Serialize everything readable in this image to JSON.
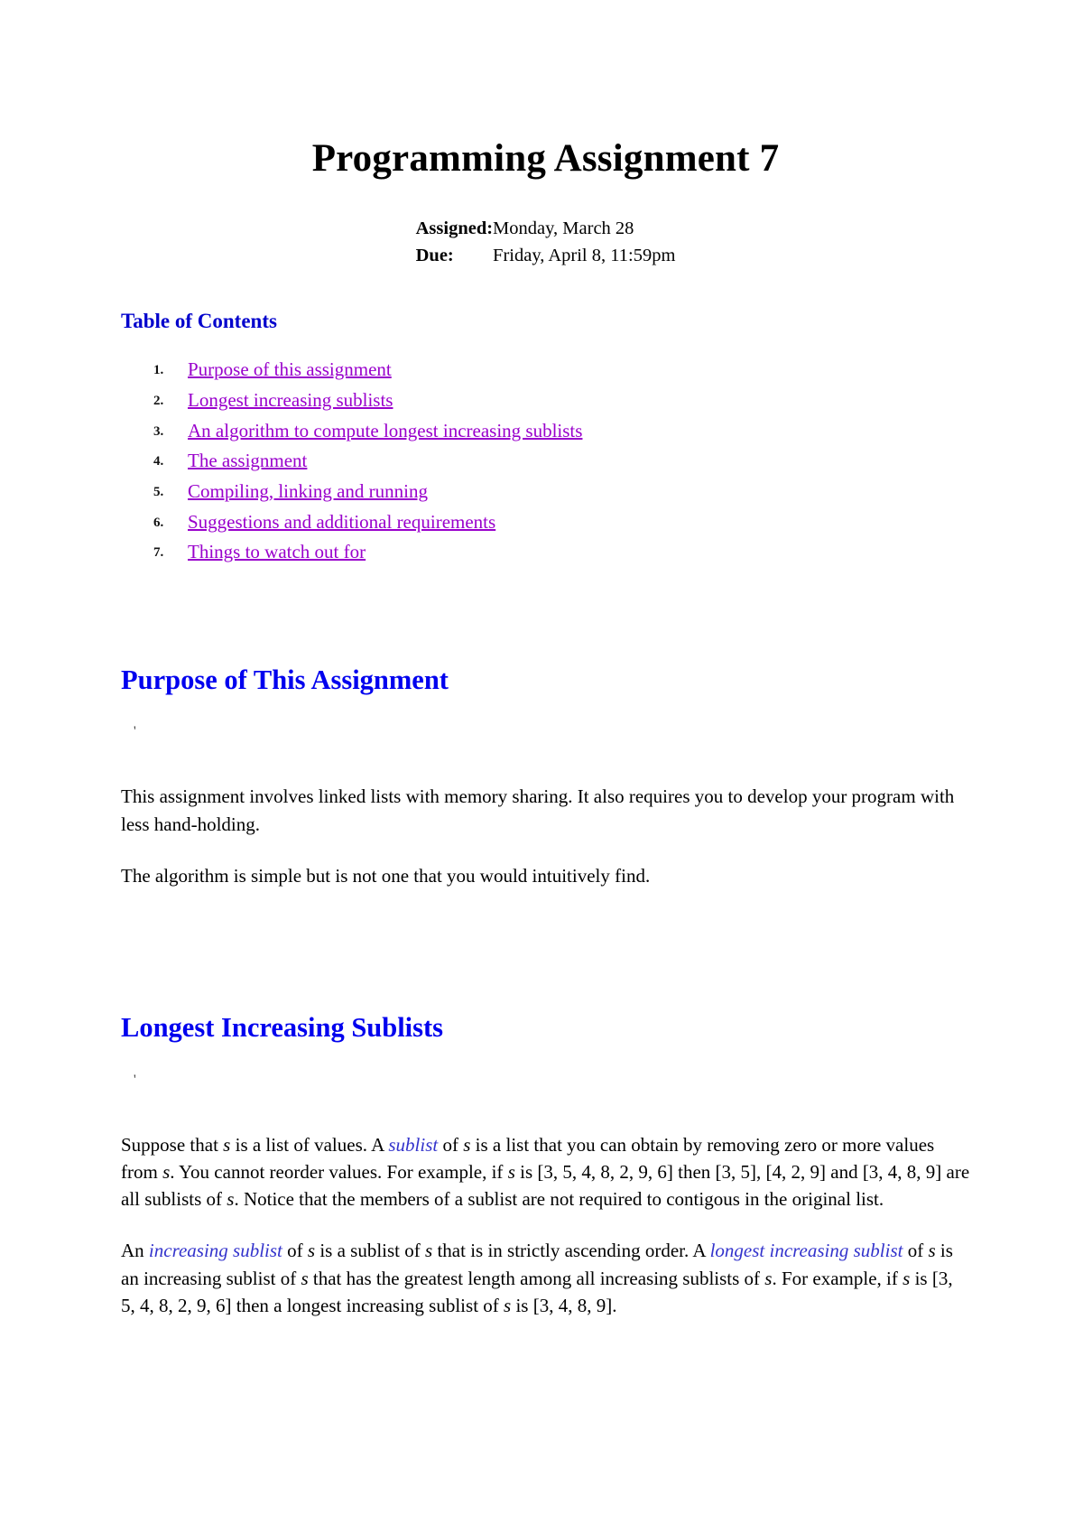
{
  "document": {
    "title": "Programming Assignment 7",
    "meta": {
      "assigned_label": "Assigned:",
      "assigned_value": "Monday, March 28",
      "due_label": "Due:",
      "due_value": "Friday, April 8, 11:59pm"
    },
    "toc": {
      "heading": "Table of Contents",
      "items": [
        "Purpose of this assignment",
        "Longest increasing sublists",
        "An algorithm to compute longest increasing sublists",
        "The assignment",
        "Compiling, linking and running",
        "Suggestions and additional requirements",
        "Things to watch out for"
      ]
    },
    "sections": [
      {
        "heading": "Purpose of This Assignment",
        "stray_mark": "'",
        "paragraphs": [
          "This assignment involves linked lists with memory sharing. It also requires you to develop your program with less hand-holding.",
          "The algorithm is simple but is not one that you would intuitively find."
        ]
      },
      {
        "heading": "Longest Increasing Sublists",
        "stray_mark": "'",
        "para1": {
          "t1": "Suppose that ",
          "v1": "s",
          "t2": " is a list of values. A ",
          "em1": "sublist",
          "t3": " of ",
          "v2": "s",
          "t4": " is a list that you can obtain by removing zero or more values from ",
          "v3": "s",
          "t5": ". You cannot reorder values. For example, if ",
          "v4": "s",
          "t6": " is [3, 5, 4, 8, 2, 9, 6] then [3, 5], [4, 2, 9] and [3, 4, 8, 9] are all sublists of ",
          "v5": "s",
          "t7": ". Notice that the members of a sublist are not required to contigous in the original list."
        },
        "para2": {
          "t1": "An ",
          "em1": "increasing sublist",
          "t2": " of ",
          "v1": "s",
          "t3": " is a sublist of ",
          "v2": "s",
          "t4": " that is in strictly ascending order. A ",
          "em2": "longest increasing sublist",
          "t5": " of ",
          "v3": "s",
          "t6": " is an increasing sublist of ",
          "v4": "s",
          "t7": " that has the greatest length among all increasing sublists of ",
          "v5": "s",
          "t8": ". For example, if ",
          "v6": "s",
          "t9": " is [3, 5, 4, 8, 2, 9, 6] then a longest increasing sublist of ",
          "v7": "s",
          "t10": " is [3, 4, 8, 9]."
        }
      }
    ],
    "colors": {
      "heading_blue": "#0000ee",
      "toc_heading_blue": "#0000cc",
      "link_purple": "#9900cc",
      "emphasis_blue": "#3333cc",
      "body_black": "#000000"
    }
  }
}
